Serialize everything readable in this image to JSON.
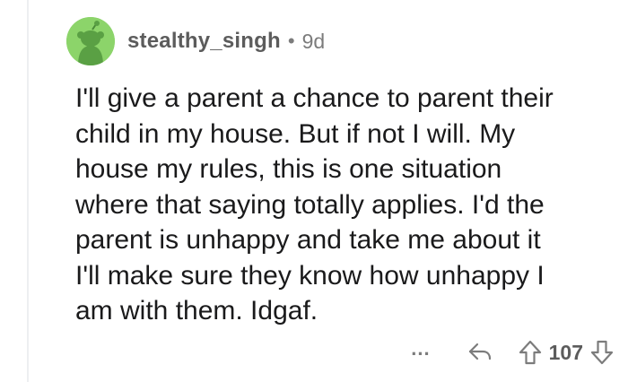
{
  "comment": {
    "username": "stealthy_singh",
    "separator": "•",
    "age": "9d",
    "body": "I'll give a parent a chance to parent their\nchild in my house. But if not I will. My\nhouse my rules, this is one situation\nwhere that saying totally applies. I'd the\nparent is unhappy and take me about it\nI'll make sure they know how unhappy I\nam with them. Idgaf.",
    "actions": {
      "more_label": "...",
      "reply_icon": "reply-icon",
      "upvote_icon": "upvote-icon",
      "score": "107",
      "downvote_icon": "downvote-icon"
    }
  },
  "colors": {
    "avatar_bg": "#8cd46a",
    "text": "#1a1a1b",
    "muted": "#7c7c7c"
  }
}
